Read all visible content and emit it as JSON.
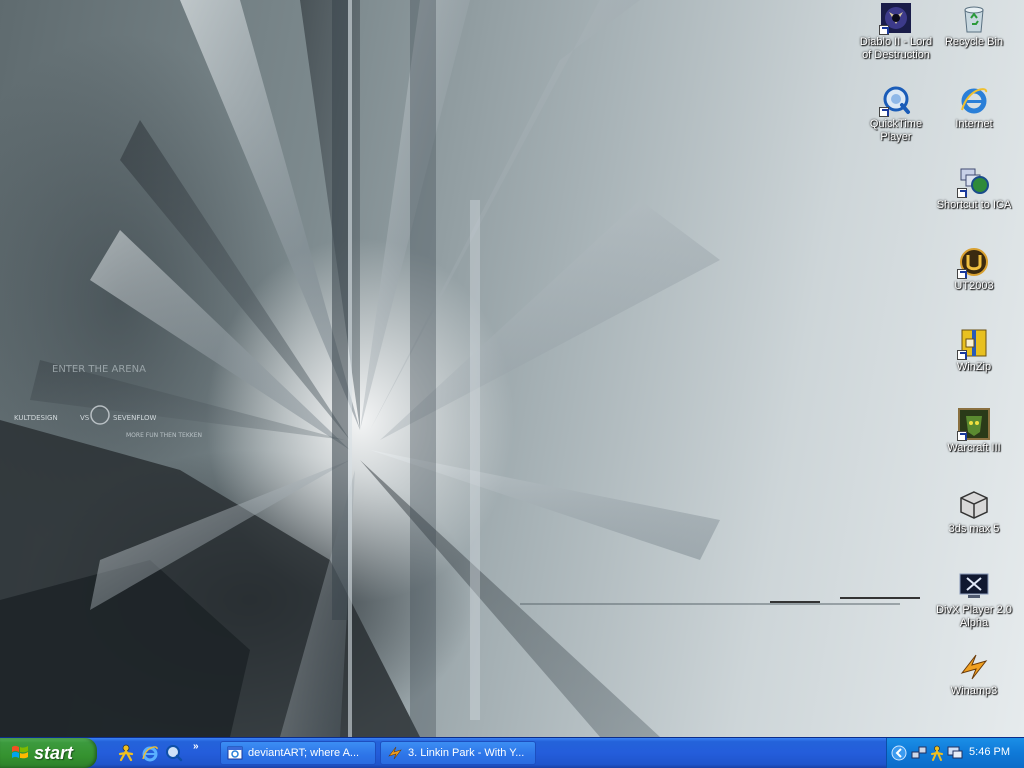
{
  "desktop": {
    "icons": [
      {
        "label": "Diablo II - Lord of Destruction",
        "icon": "diablo-icon",
        "shortcut": true
      },
      {
        "label": "Recycle Bin",
        "icon": "recycle-bin-icon",
        "shortcut": false
      },
      {
        "label": "QuickTime Player",
        "icon": "quicktime-icon",
        "shortcut": true
      },
      {
        "label": "Internet",
        "icon": "internet-explorer-icon",
        "shortcut": false
      },
      {
        "label": "Shortcut to ICA",
        "icon": "ica-icon",
        "shortcut": true
      },
      {
        "label": "UT2003",
        "icon": "ut2003-icon",
        "shortcut": true
      },
      {
        "label": "WinZip",
        "icon": "winzip-icon",
        "shortcut": true
      },
      {
        "label": "Warcraft III",
        "icon": "warcraft-icon",
        "shortcut": true
      },
      {
        "label": "3ds max 5",
        "icon": "3ds-max-icon",
        "shortcut": false
      },
      {
        "label": "DivX Player 2.0 Alpha",
        "icon": "divx-icon",
        "shortcut": false
      },
      {
        "label": "Winamp3",
        "icon": "winamp-icon",
        "shortcut": false
      }
    ],
    "wallpaper": {
      "texts": [
        "ENTER THE ARENA",
        "KULTDESIGN",
        "VS",
        "SEVENFLOW",
        "MORE FUN THEN TEKKEN"
      ]
    }
  },
  "taskbar": {
    "start_label": "start",
    "quick_launch": [
      "aim-icon",
      "internet-explorer-icon",
      "quicktime-icon"
    ],
    "chevron": "»",
    "tasks": [
      {
        "label": "deviantART; where A...",
        "icon": "browser-window-icon"
      },
      {
        "label": "3. Linkin Park - With Y...",
        "icon": "winamp-icon"
      }
    ],
    "tray_icons": [
      "show-hidden-icons-icon",
      "network-icon",
      "aim-icon",
      "monitor-icon"
    ],
    "clock": "5:46 PM"
  },
  "colors": {
    "taskbar_blue": "#245ddb",
    "start_green": "#3c9a3e",
    "tray_blue": "#0f79d8"
  }
}
